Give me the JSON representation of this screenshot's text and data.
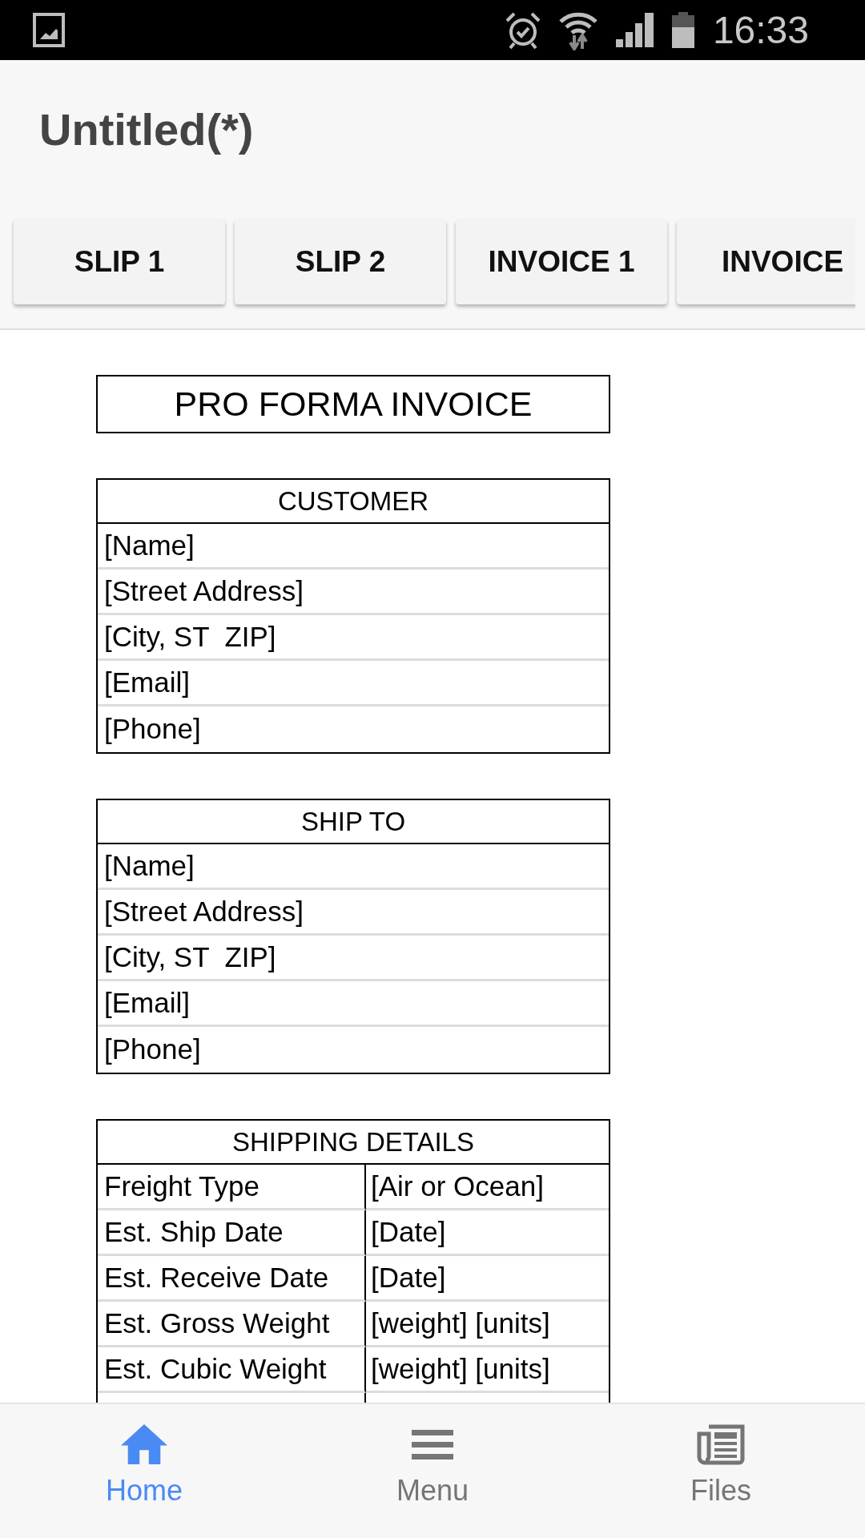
{
  "status_bar": {
    "time": "16:33"
  },
  "app_bar": {
    "title": "Untitled(*)"
  },
  "template_buttons": [
    {
      "label": "SLIP 1"
    },
    {
      "label": "SLIP 2"
    },
    {
      "label": "INVOICE 1"
    },
    {
      "label": "INVOICE"
    }
  ],
  "document": {
    "title": "PRO FORMA INVOICE",
    "sections": [
      {
        "kind": "list",
        "heading": "CUSTOMER",
        "rows": [
          "[Name]",
          "[Street Address]",
          "[City, ST  ZIP]",
          "[Email]",
          "[Phone]"
        ]
      },
      {
        "kind": "list",
        "heading": "SHIP TO",
        "rows": [
          "[Name]",
          "[Street Address]",
          "[City, ST  ZIP]",
          "[Email]",
          "[Phone]"
        ]
      },
      {
        "kind": "pairs",
        "heading": "SHIPPING DETAILS",
        "rows": [
          {
            "label": "Freight Type",
            "value": "[Air or Ocean]"
          },
          {
            "label": "Est. Ship Date",
            "value": "[Date]"
          },
          {
            "label": "Est. Receive Date",
            "value": "[Date]"
          },
          {
            "label": "Est. Gross Weight",
            "value": "[weight] [units]"
          },
          {
            "label": "Est. Cubic Weight",
            "value": "[weight] [units]"
          }
        ]
      }
    ]
  },
  "bottom_nav": [
    {
      "label": "Home",
      "selected": true
    },
    {
      "label": "Menu",
      "selected": false
    },
    {
      "label": "Files",
      "selected": false
    }
  ]
}
